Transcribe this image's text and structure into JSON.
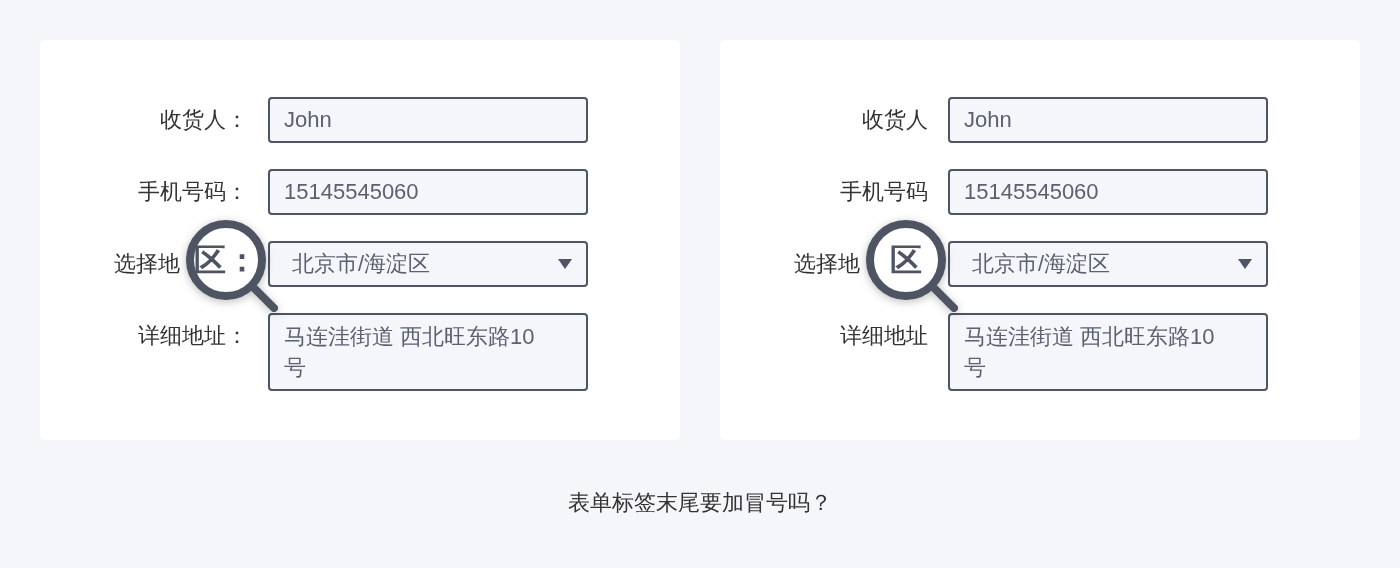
{
  "cards": [
    {
      "rows": [
        {
          "kind": "input",
          "label": "收货人：",
          "value": "John"
        },
        {
          "kind": "input",
          "label": "手机号码：",
          "value": "15145545060"
        },
        {
          "kind": "select",
          "label": "选择地",
          "value": "北京市/海淀区",
          "magnified": "区："
        },
        {
          "kind": "textarea",
          "label": "详细地址：",
          "value": "马连洼街道 西北旺东路10号"
        }
      ]
    },
    {
      "rows": [
        {
          "kind": "input",
          "label": "收货人",
          "value": "John"
        },
        {
          "kind": "input",
          "label": "手机号码",
          "value": "15145545060"
        },
        {
          "kind": "select",
          "label": "选择地",
          "value": "北京市/海淀区",
          "magnified": "区"
        },
        {
          "kind": "textarea",
          "label": "详细地址",
          "value": "马连洼街道 西北旺东路10号"
        }
      ]
    }
  ],
  "caption": "表单标签末尾要加冒号吗？"
}
